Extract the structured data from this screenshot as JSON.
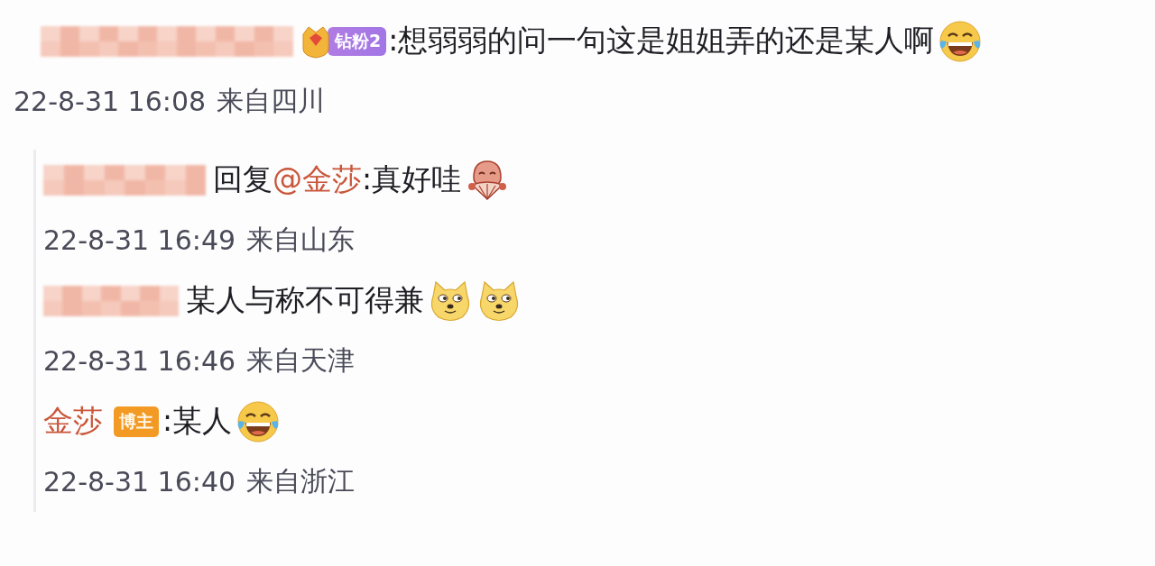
{
  "comment": {
    "author": {
      "redacted": true
    },
    "badge": {
      "kind": "fan",
      "label": "钻粉2"
    },
    "text": ":想弱弱的问一句这是姐姐弄的还是某人啊",
    "emojis": [
      {
        "kind": "laugh"
      }
    ],
    "time": "22-8-31 16:08",
    "location": "来自四川"
  },
  "replies": [
    {
      "author": {
        "redacted": true
      },
      "prefix": "回复",
      "mention": "@金莎",
      "text": ":真好哇",
      "emojis": [
        {
          "kind": "fan-face"
        }
      ],
      "time": "22-8-31 16:49",
      "location": "来自山东"
    },
    {
      "author": {
        "redacted": true
      },
      "text": "某人与称不可得兼",
      "emojis": [
        {
          "kind": "doge"
        },
        {
          "kind": "doge"
        }
      ],
      "time": "22-8-31 16:46",
      "location": "来自天津"
    },
    {
      "author": {
        "redacted": false,
        "name": "金莎"
      },
      "badge": {
        "kind": "author",
        "label": "博主"
      },
      "text": ":某人",
      "emojis": [
        {
          "kind": "laugh"
        }
      ],
      "time": "22-8-31 16:40",
      "location": "来自浙江"
    }
  ]
}
